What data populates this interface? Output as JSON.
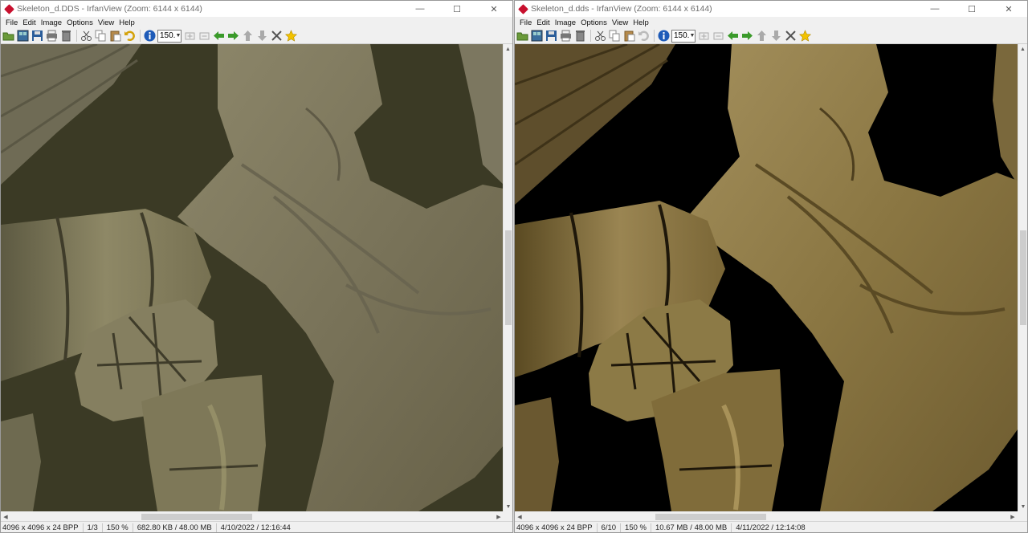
{
  "colors": {
    "left_bg": "#3b3a25",
    "right_bg": "#000000",
    "bone_left": "#7f7a5e",
    "bone_right": "#8f7c48",
    "accent_red": "#c8102e"
  },
  "menu": [
    "File",
    "Edit",
    "Image",
    "Options",
    "View",
    "Help"
  ],
  "window_controls": {
    "minimize": "—",
    "maximize": "☐",
    "close": "✕"
  },
  "toolbar": {
    "zoom_value": "150.",
    "icons": [
      "open-icon",
      "thumbnails-icon",
      "save-icon",
      "print-icon",
      "delete-icon",
      "cut-icon",
      "copy-icon",
      "paste-icon",
      "undo-icon",
      "info-icon",
      "zoom-select",
      "zoom-in-icon",
      "zoom-out-icon",
      "prev-file-icon",
      "next-file-icon",
      "page-up-icon",
      "page-down-icon",
      "tools-icon",
      "favorite-icon"
    ]
  },
  "left": {
    "title": "Skeleton_d.DDS - IrfanView (Zoom: 6144 x 6144)",
    "status": {
      "dims": "4096 x 4096 x 24 BPP",
      "index": "1/3",
      "zoom": "150 %",
      "size": "682.80 KB / 48.00 MB",
      "date": "4/10/2022 / 12:16:44"
    }
  },
  "right": {
    "title": "Skeleton_d.dds - IrfanView (Zoom: 6144 x 6144)",
    "status": {
      "dims": "4096 x 4096 x 24 BPP",
      "index": "6/10",
      "zoom": "150 %",
      "size": "10.67 MB / 48.00 MB",
      "date": "4/11/2022 / 12:14:08"
    }
  }
}
